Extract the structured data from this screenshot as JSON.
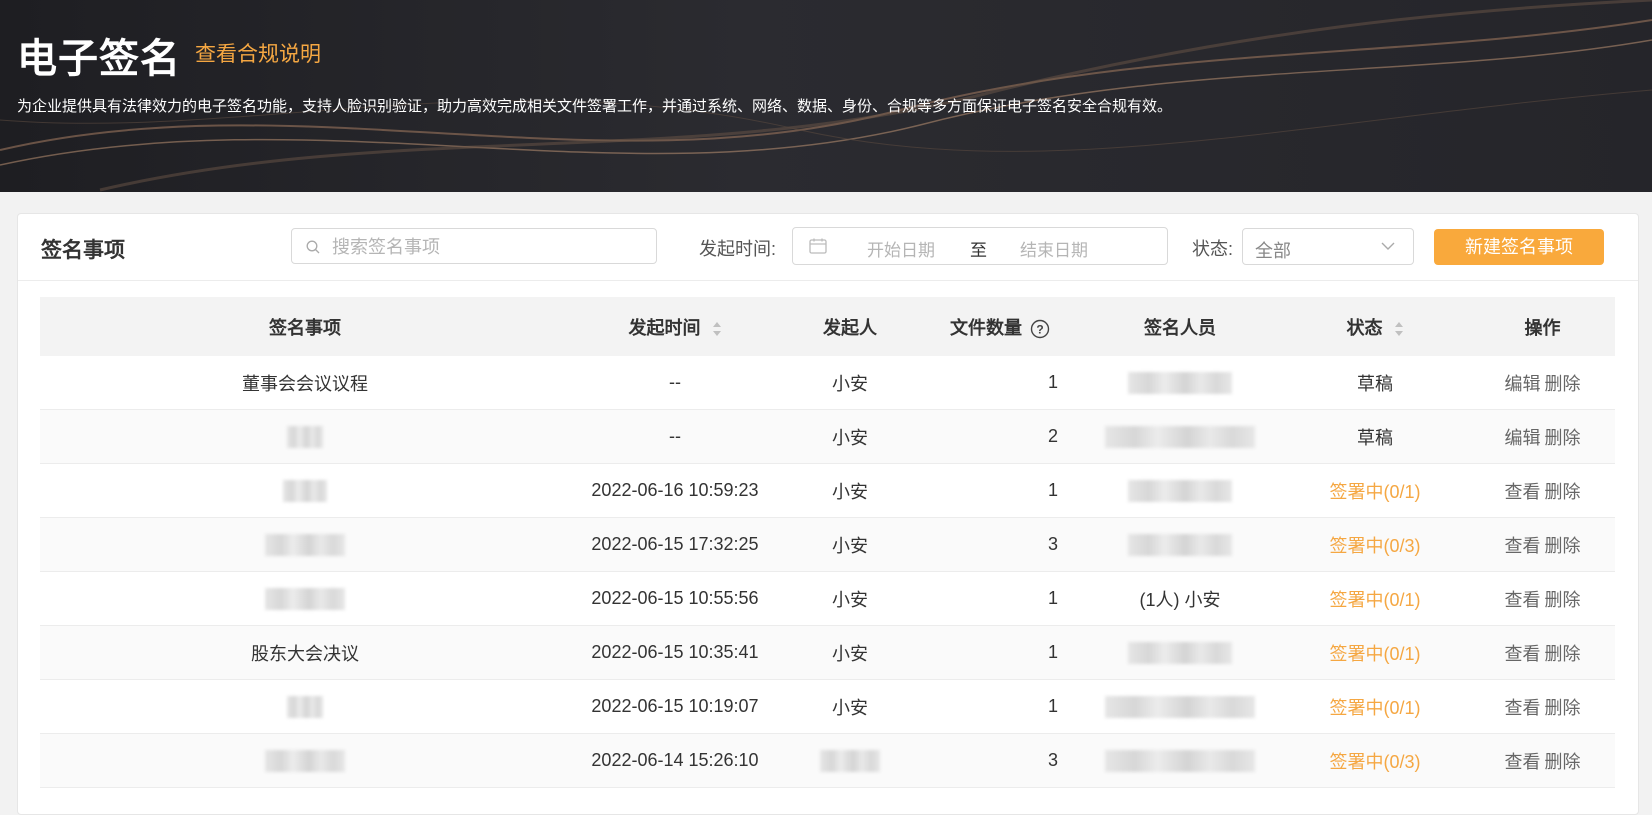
{
  "banner": {
    "title": "电子签名",
    "link": "查看合规说明",
    "description": "为企业提供具有法律效力的电子签名功能，支持人脸识别验证，助力高效完成相关文件签署工作，并通过系统、网络、数据、身份、合规等多方面保证电子签名安全合规有效。"
  },
  "toolbar": {
    "title": "签名事项",
    "search_placeholder": "搜索签名事项",
    "date_label": "发起时间:",
    "date_start_placeholder": "开始日期",
    "date_separator": "至",
    "date_end_placeholder": "结束日期",
    "status_label": "状态:",
    "status_value": "全部",
    "new_button": "新建签名事项"
  },
  "table": {
    "headers": {
      "item": "签名事项",
      "time": "发起时间",
      "initiator": "发起人",
      "file_count": "文件数量",
      "signers": "签名人员",
      "status": "状态",
      "actions": "操作"
    },
    "rows": [
      {
        "item": "董事会会议议程",
        "time": "--",
        "initiator": "小安",
        "file_count": "1",
        "signers": "",
        "status": "草稿",
        "status_kind": "draft",
        "action1": "编辑",
        "action2": "删除"
      },
      {
        "item": "",
        "time": "--",
        "initiator": "小安",
        "file_count": "2",
        "signers": "",
        "status": "草稿",
        "status_kind": "draft",
        "action1": "编辑",
        "action2": "删除"
      },
      {
        "item": "",
        "time": "2022-06-16 10:59:23",
        "initiator": "小安",
        "file_count": "1",
        "signers": "",
        "status": "签署中(0/1)",
        "status_kind": "signing",
        "action1": "查看",
        "action2": "删除"
      },
      {
        "item": "",
        "time": "2022-06-15 17:32:25",
        "initiator": "小安",
        "file_count": "3",
        "signers": "",
        "status": "签署中(0/3)",
        "status_kind": "signing",
        "action1": "查看",
        "action2": "删除"
      },
      {
        "item": "",
        "time": "2022-06-15 10:55:56",
        "initiator": "小安",
        "file_count": "1",
        "signers": "(1人) 小安",
        "status": "签署中(0/1)",
        "status_kind": "signing",
        "action1": "查看",
        "action2": "删除"
      },
      {
        "item": "股东大会决议",
        "time": "2022-06-15 10:35:41",
        "initiator": "小安",
        "file_count": "1",
        "signers": "",
        "status": "签署中(0/1)",
        "status_kind": "signing",
        "action1": "查看",
        "action2": "删除"
      },
      {
        "item": "",
        "time": "2022-06-15 10:19:07",
        "initiator": "小安",
        "file_count": "1",
        "signers": "",
        "status": "签署中(0/1)",
        "status_kind": "signing",
        "action1": "查看",
        "action2": "删除"
      },
      {
        "item": "",
        "time": "2022-06-14 15:26:10",
        "initiator": "",
        "file_count": "3",
        "signers": "",
        "status": "签署中(0/3)",
        "status_kind": "signing",
        "action1": "查看",
        "action2": "删除"
      }
    ]
  },
  "colors": {
    "accent": "#f9a93c",
    "status_signing": "#f5a742",
    "banner_bg": "#25252a"
  }
}
